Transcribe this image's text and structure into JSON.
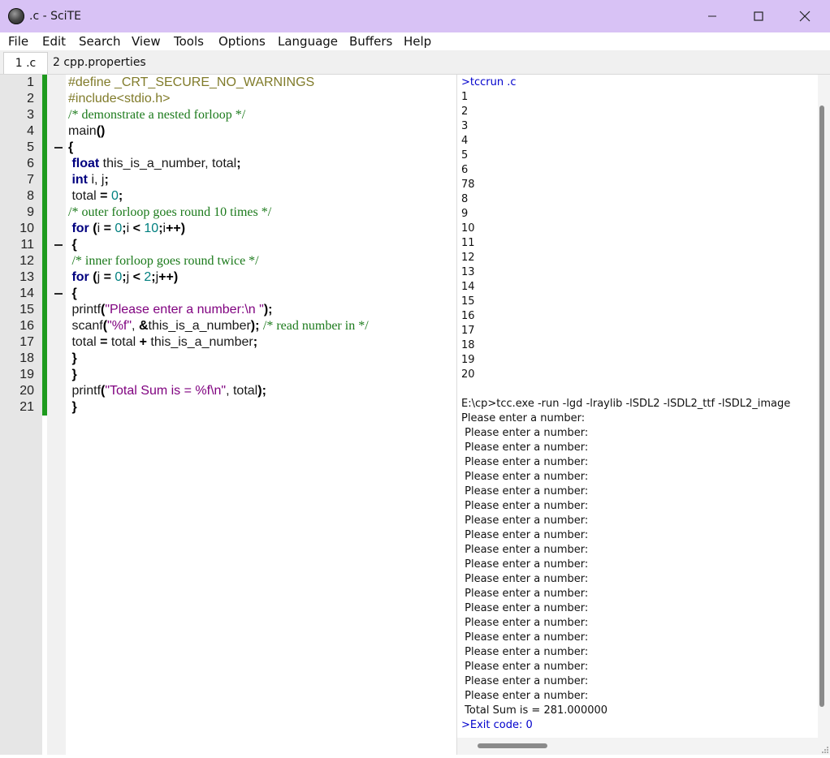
{
  "window": {
    "title": ".c - SciTE",
    "icon": "scite-globe-icon"
  },
  "menu": [
    "File",
    "Edit",
    "Search",
    "View",
    "Tools",
    "Options",
    "Language",
    "Buffers",
    "Help"
  ],
  "tabs": [
    {
      "label": "1 .c",
      "active": true
    },
    {
      "label": "2 cpp.properties",
      "active": false
    }
  ],
  "editor": {
    "line_numbers": [
      "1",
      "2",
      "3",
      "4",
      "5",
      "6",
      "7",
      "8",
      "9",
      "10",
      "11",
      "12",
      "13",
      "14",
      "15",
      "16",
      "17",
      "18",
      "19",
      "20",
      "21"
    ],
    "fold_markers_on_lines": [
      5,
      11,
      14
    ],
    "lines": [
      [
        [
          "pre",
          "#define _CRT_SECURE_NO_WARNINGS"
        ]
      ],
      [
        [
          "pre",
          "#include<stdio.h>"
        ]
      ],
      [
        [
          "cmt",
          "/* demonstrate a nested forloop */"
        ]
      ],
      [
        [
          "txt",
          "main"
        ],
        [
          "op",
          "()"
        ]
      ],
      [
        [
          "op",
          "{"
        ]
      ],
      [
        [
          "txt",
          " "
        ],
        [
          "kw",
          "float"
        ],
        [
          "txt",
          " this_is_a_number, total"
        ],
        [
          "op",
          ";"
        ]
      ],
      [
        [
          "txt",
          " "
        ],
        [
          "kw",
          "int"
        ],
        [
          "txt",
          " i, j"
        ],
        [
          "op",
          ";"
        ]
      ],
      [
        [
          "txt",
          " total "
        ],
        [
          "op",
          "="
        ],
        [
          "txt",
          " "
        ],
        [
          "num",
          "0"
        ],
        [
          "op",
          ";"
        ]
      ],
      [
        [
          "cmt",
          "/* outer forloop goes round 10 times */"
        ]
      ],
      [
        [
          "txt",
          " "
        ],
        [
          "kw",
          "for"
        ],
        [
          "txt",
          " "
        ],
        [
          "op",
          "("
        ],
        [
          "txt",
          "i "
        ],
        [
          "op",
          "="
        ],
        [
          "txt",
          " "
        ],
        [
          "num",
          "0"
        ],
        [
          "op",
          ";"
        ],
        [
          "txt",
          "i "
        ],
        [
          "op",
          "<"
        ],
        [
          "txt",
          " "
        ],
        [
          "num",
          "10"
        ],
        [
          "op",
          ";"
        ],
        [
          "txt",
          "i"
        ],
        [
          "op",
          "++)"
        ]
      ],
      [
        [
          "txt",
          " "
        ],
        [
          "op",
          "{"
        ]
      ],
      [
        [
          "txt",
          " "
        ],
        [
          "cmt",
          "/* inner forloop goes round twice */"
        ]
      ],
      [
        [
          "txt",
          " "
        ],
        [
          "kw",
          "for"
        ],
        [
          "txt",
          " "
        ],
        [
          "op",
          "("
        ],
        [
          "txt",
          "j "
        ],
        [
          "op",
          "="
        ],
        [
          "txt",
          " "
        ],
        [
          "num",
          "0"
        ],
        [
          "op",
          ";"
        ],
        [
          "txt",
          "j "
        ],
        [
          "op",
          "<"
        ],
        [
          "txt",
          " "
        ],
        [
          "num",
          "2"
        ],
        [
          "op",
          ";"
        ],
        [
          "txt",
          "j"
        ],
        [
          "op",
          "++)"
        ]
      ],
      [
        [
          "txt",
          " "
        ],
        [
          "op",
          "{"
        ]
      ],
      [
        [
          "txt",
          " printf"
        ],
        [
          "op",
          "("
        ],
        [
          "str",
          "\"Please enter a number:\\n \""
        ],
        [
          "op",
          ");"
        ]
      ],
      [
        [
          "txt",
          " scanf"
        ],
        [
          "op",
          "("
        ],
        [
          "str",
          "\"%f\""
        ],
        [
          "txt",
          ", "
        ],
        [
          "op",
          "&"
        ],
        [
          "txt",
          "this_is_a_number"
        ],
        [
          "op",
          ");"
        ],
        [
          "txt",
          " "
        ],
        [
          "cmt",
          "/* read number in */"
        ]
      ],
      [
        [
          "txt",
          " total "
        ],
        [
          "op",
          "="
        ],
        [
          "txt",
          " total "
        ],
        [
          "op",
          "+"
        ],
        [
          "txt",
          " this_is_a_number"
        ],
        [
          "op",
          ";"
        ]
      ],
      [
        [
          "txt",
          " "
        ],
        [
          "op",
          "}"
        ]
      ],
      [
        [
          "txt",
          " "
        ],
        [
          "op",
          "}"
        ]
      ],
      [
        [
          "txt",
          " printf"
        ],
        [
          "op",
          "("
        ],
        [
          "str",
          "\"Total Sum is = %f\\n\""
        ],
        [
          "txt",
          ", total"
        ],
        [
          "op",
          ");"
        ]
      ],
      [
        [
          "txt",
          " "
        ],
        [
          "op",
          "}"
        ]
      ]
    ]
  },
  "output": {
    "lines": [
      {
        "text": ">tccrun .c",
        "style": "blue"
      },
      {
        "text": "1"
      },
      {
        "text": "2"
      },
      {
        "text": "3"
      },
      {
        "text": "4"
      },
      {
        "text": "5"
      },
      {
        "text": "6"
      },
      {
        "text": "78"
      },
      {
        "text": "8"
      },
      {
        "text": "9"
      },
      {
        "text": "10"
      },
      {
        "text": "11"
      },
      {
        "text": "12"
      },
      {
        "text": "13"
      },
      {
        "text": "14"
      },
      {
        "text": "15"
      },
      {
        "text": "16"
      },
      {
        "text": "17"
      },
      {
        "text": "18"
      },
      {
        "text": "19"
      },
      {
        "text": "20"
      },
      {
        "text": ""
      },
      {
        "text": "E:\\cp>tcc.exe -run -lgd -lraylib -lSDL2 -lSDL2_ttf -lSDL2_image"
      },
      {
        "text": "Please enter a number:"
      },
      {
        "text": " Please enter a number:"
      },
      {
        "text": " Please enter a number:"
      },
      {
        "text": " Please enter a number:"
      },
      {
        "text": " Please enter a number:"
      },
      {
        "text": " Please enter a number:"
      },
      {
        "text": " Please enter a number:"
      },
      {
        "text": " Please enter a number:"
      },
      {
        "text": " Please enter a number:"
      },
      {
        "text": " Please enter a number:"
      },
      {
        "text": " Please enter a number:"
      },
      {
        "text": " Please enter a number:"
      },
      {
        "text": " Please enter a number:"
      },
      {
        "text": " Please enter a number:"
      },
      {
        "text": " Please enter a number:"
      },
      {
        "text": " Please enter a number:"
      },
      {
        "text": " Please enter a number:"
      },
      {
        "text": " Please enter a number:"
      },
      {
        "text": " Please enter a number:"
      },
      {
        "text": " Please enter a number:"
      },
      {
        "text": " Total Sum is = 281.000000"
      },
      {
        "text": ">Exit code: 0",
        "style": "blue"
      }
    ]
  },
  "colors": {
    "titlebar": "#d8c2f5",
    "change_bar": "#1e9a1e",
    "preprocessor": "#807b2a",
    "comment": "#1b7a1b",
    "keyword": "#00007f",
    "number": "#007f7f",
    "string": "#7f007f",
    "output_command": "#0000cc"
  }
}
